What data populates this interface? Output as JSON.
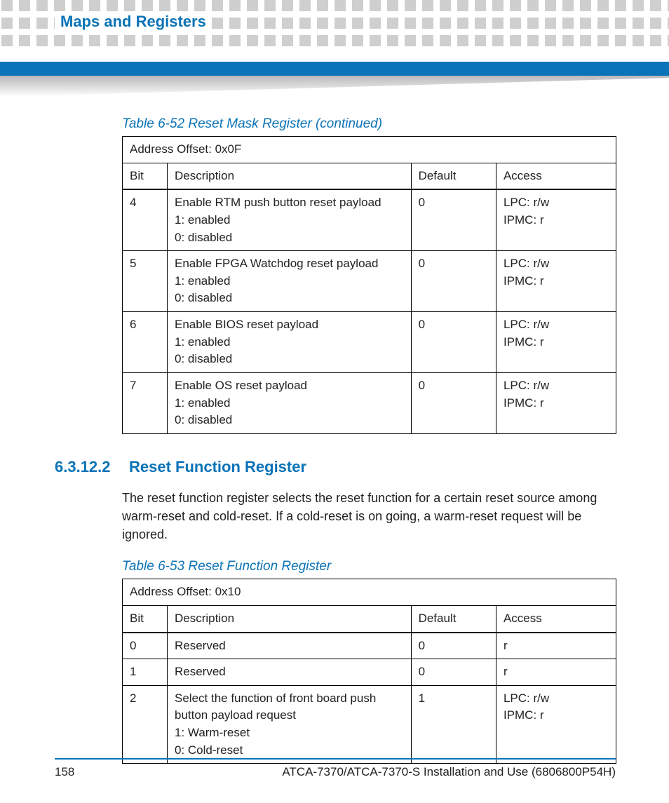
{
  "header": {
    "chapter_title": "Maps and Registers"
  },
  "table52": {
    "caption": "Table 6-52 Reset Mask Register  (continued)",
    "address_offset": "Address Offset: 0x0F",
    "columns": {
      "bit": "Bit",
      "description": "Description",
      "default": "Default",
      "access": "Access"
    },
    "rows": [
      {
        "bit": "4",
        "desc_l1": "Enable RTM push button reset payload",
        "desc_l2": "1: enabled",
        "desc_l3": "0: disabled",
        "default": "0",
        "access_l1": "LPC: r/w",
        "access_l2": "IPMC: r"
      },
      {
        "bit": "5",
        "desc_l1": "Enable FPGA Watchdog reset payload",
        "desc_l2": "1: enabled",
        "desc_l3": "0: disabled",
        "default": "0",
        "access_l1": "LPC: r/w",
        "access_l2": "IPMC: r"
      },
      {
        "bit": "6",
        "desc_l1": "Enable BIOS reset payload",
        "desc_l2": "1: enabled",
        "desc_l3": "0: disabled",
        "default": "0",
        "access_l1": "LPC: r/w",
        "access_l2": "IPMC: r"
      },
      {
        "bit": "7",
        "desc_l1": "Enable OS reset payload",
        "desc_l2": "1: enabled",
        "desc_l3": "0: disabled",
        "default": "0",
        "access_l1": "LPC: r/w",
        "access_l2": "IPMC: r"
      }
    ]
  },
  "section": {
    "number": "6.3.12.2",
    "title": "Reset Function Register",
    "paragraph": "The reset function register selects the reset function for a certain reset source among warm-reset and cold-reset. If a cold-reset is on going, a warm-reset request will be ignored."
  },
  "table53": {
    "caption": "Table 6-53 Reset Function Register",
    "address_offset": "Address Offset: 0x10",
    "columns": {
      "bit": "Bit",
      "description": "Description",
      "default": "Default",
      "access": "Access"
    },
    "rows": [
      {
        "bit": "0",
        "desc_l1": "Reserved",
        "desc_l2": "",
        "desc_l3": "",
        "desc_l4": "",
        "default": "0",
        "access_l1": "r",
        "access_l2": ""
      },
      {
        "bit": "1",
        "desc_l1": "Reserved",
        "desc_l2": "",
        "desc_l3": "",
        "desc_l4": "",
        "default": "0",
        "access_l1": "r",
        "access_l2": ""
      },
      {
        "bit": "2",
        "desc_l1": "Select the function of front board push button payload request",
        "desc_l2": "1: Warm-reset",
        "desc_l3": "0: Cold-reset",
        "desc_l4": "",
        "default": "1",
        "access_l1": "LPC: r/w",
        "access_l2": "IPMC: r"
      }
    ]
  },
  "footer": {
    "page_number": "158",
    "doc_title": "ATCA-7370/ATCA-7370-S Installation and Use (6806800P54H)"
  }
}
